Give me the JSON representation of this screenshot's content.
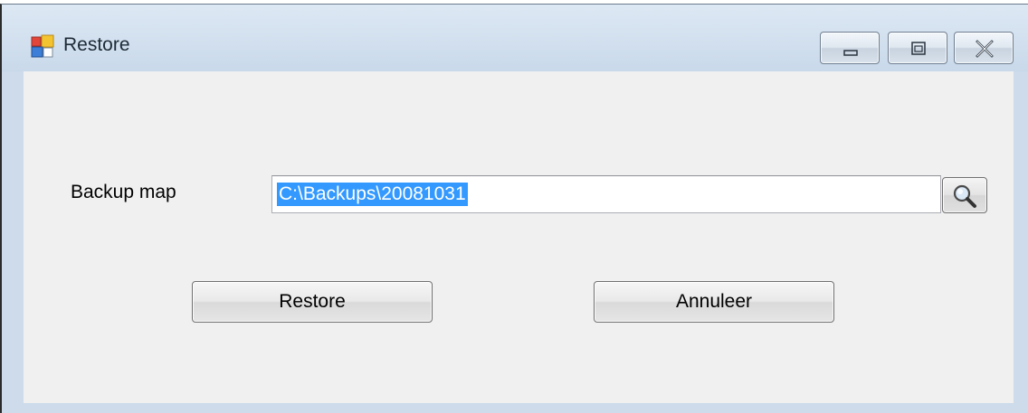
{
  "window": {
    "title": "Restore",
    "icon": "restore-app-icon"
  },
  "caption_buttons": {
    "minimize": "minimize-icon",
    "maximize": "maximize-icon",
    "close": "close-icon"
  },
  "form": {
    "backup_label": "Backup map",
    "backup_path": "C:\\Backups\\20081031",
    "browse_icon": "magnifier-icon"
  },
  "buttons": {
    "restore_label": "Restore",
    "cancel_label": "Annuleer"
  },
  "colors": {
    "selection": "#3399ff",
    "titlebar": "#cddbea",
    "client": "#f0f0f0"
  }
}
